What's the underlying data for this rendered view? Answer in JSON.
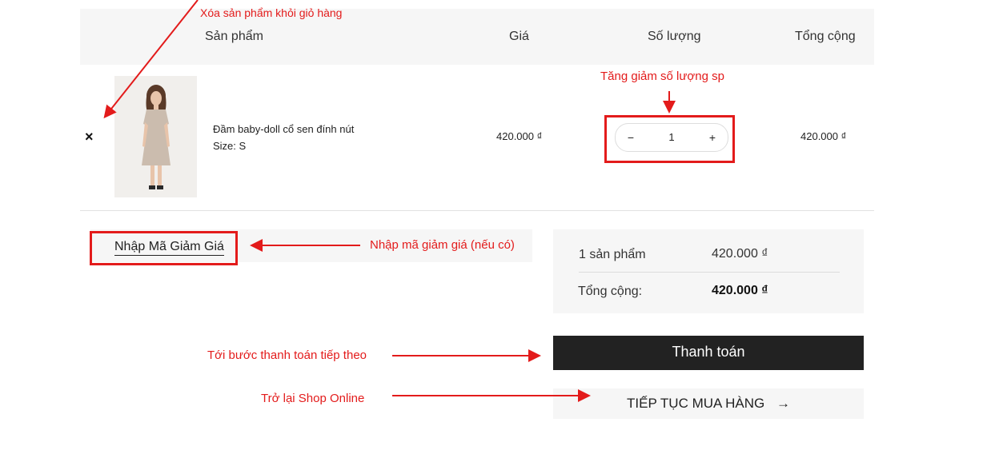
{
  "cart": {
    "headers": {
      "product": "Sản phẩm",
      "price": "Giá",
      "quantity": "Số lượng",
      "total": "Tổng cộng"
    },
    "items": [
      {
        "remove_icon": "×",
        "name": "Đầm baby-doll cổ sen đính nút",
        "size": "Size: S",
        "price": "420.000 ₫",
        "qty_minus": "−",
        "qty": "1",
        "qty_plus": "+",
        "total": "420.000 ₫"
      }
    ]
  },
  "coupon": {
    "label": "Nhập Mã Giảm Giá"
  },
  "summary": {
    "count_label": "1 sản phẩm",
    "count_value": "420.000 ₫",
    "total_label": "Tổng cộng:",
    "total_value": "420.000 ₫"
  },
  "buttons": {
    "checkout": "Thanh toán",
    "continue": "TIẾP TỤC MUA HÀNG",
    "continue_icon": "→"
  },
  "annotations": {
    "remove": "Xóa sản phẩm khỏi giỏ hàng",
    "quantity": "Tăng giảm số lượng sp",
    "coupon": "Nhập mã giảm giá (nếu có)",
    "checkout": "Tới bước thanh toán tiếp theo",
    "continue": "Trở lại Shop Online"
  },
  "colors": {
    "annotation": "#e31b1b",
    "checkout_bg": "#222222",
    "panel_bg": "#f6f6f6"
  }
}
